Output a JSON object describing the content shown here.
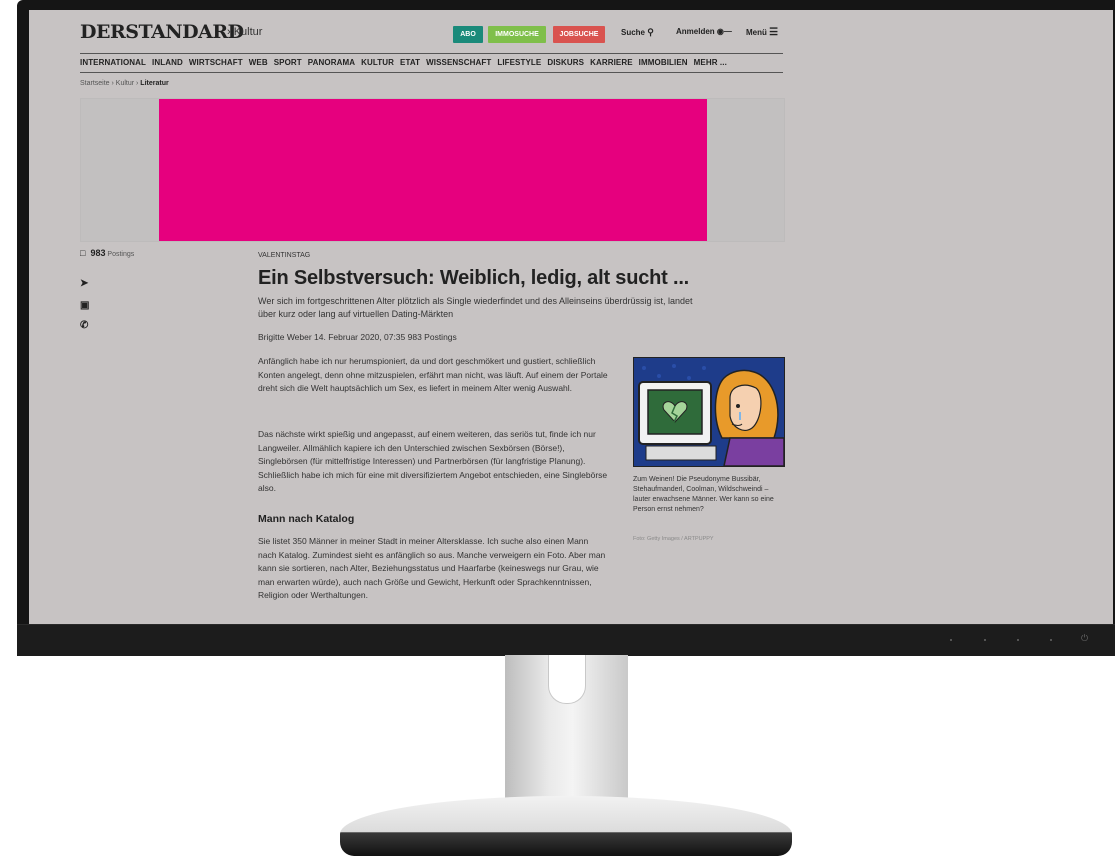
{
  "header": {
    "logo": "DERSTANDARD",
    "section": "› Kultur",
    "abo": "ABO",
    "immosuche": "IMMOSUCHE",
    "jobsuche": "JOBSUCHE",
    "suche": "Suche",
    "anmelden": "Anmelden",
    "menu": "Menü"
  },
  "nav": [
    "INTERNATIONAL",
    "INLAND",
    "WIRTSCHAFT",
    "WEB",
    "SPORT",
    "PANORAMA",
    "KULTUR",
    "ETAT",
    "WISSENSCHAFT",
    "LIFESTYLE",
    "DISKURS",
    "KARRIERE",
    "IMMOBILIEN",
    "MEHR ..."
  ],
  "breadcrumb": {
    "path": "Startseite › Kultur › ",
    "current": "Literatur"
  },
  "sidebar": {
    "count": "983",
    "label": "Postings"
  },
  "article": {
    "kicker": "VALENTINSTAG",
    "headline": "Ein Selbstversuch: Weiblich, ledig, alt sucht ...",
    "lead": "Wer sich im fortgeschrittenen Alter plötzlich als Single wiederfindet und des Alleinseins überdrüssig ist, landet über kurz oder lang auf virtuellen Dating-Märkten",
    "byline": "Brigitte Weber  14. Februar 2020, 07:35  983 Postings",
    "p1": "Anfänglich habe ich nur herumspioniert, da und dort geschmökert und gustiert, schließlich Konten angelegt, denn ohne mitzuspielen, erfährt man nicht, was läuft. Auf einem der Portale dreht sich die Welt hauptsächlich um Sex, es liefert in meinem Alter wenig Auswahl.",
    "p2": "Das nächste wirkt spießig und angepasst, auf einem weiteren, das seriös tut, finde ich nur Langweiler. Allmählich kapiere ich den Unterschied zwischen Sexbörsen (Börse!), Singlebörsen (für mittelfristige Interessen) und Partnerbörsen (für langfristige Planung). Schließlich habe ich mich für eine mit diversifiziertem Angebot entschieden, eine Singlebörse also.",
    "subhead": "Mann nach Katalog",
    "p3": "Sie listet 350 Männer in meiner Stadt in meiner Altersklasse. Ich suche also einen Mann nach Katalog. Zumindest sieht es anfänglich so aus. Manche verweigern ein Foto. Aber man kann sie sortieren, nach Alter, Beziehungsstatus und Haarfarbe (keineswegs nur Grau, wie man erwarten würde), auch nach Größe und Gewicht, Herkunft oder Sprachkenntnissen, Religion oder Werthaltungen.",
    "caption": "Zum Weinen! Die Pseudonyme Bussibär, Stehaufmanderl, Coolman, Wildschweindi – lauter erwachsene Männer. Wer kann so eine Person ernst nehmen?",
    "credit": "Foto: Getty Images / ARTPUPPY"
  }
}
